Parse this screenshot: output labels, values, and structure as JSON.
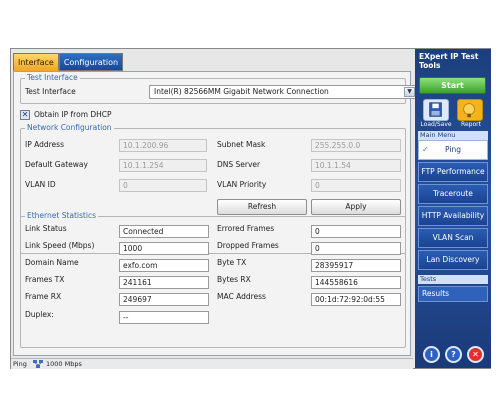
{
  "tabs": [
    "Interface",
    "Configuration"
  ],
  "test_interface": {
    "group_title": "Test Interface",
    "label": "Test Interface",
    "value": "Intel(R) 82566MM Gigabit Network Connection"
  },
  "dhcp": {
    "label": "Obtain IP from DHCP",
    "checked": true
  },
  "network": {
    "group_title": "Network Configuration",
    "ip_label": "IP Address",
    "ip_value": "10.1.200.96",
    "subnet_label": "Subnet Mask",
    "subnet_value": "255.255.0.0",
    "gateway_label": "Default Gateway",
    "gateway_value": "10.1.1.254",
    "dns_label": "DNS Server",
    "dns_value": "10.1.1.54",
    "vlan_id_label": "VLAN ID",
    "vlan_id_value": "0",
    "vlan_priority_label": "VLAN Priority",
    "vlan_priority_value": "0",
    "refresh_label": "Refresh",
    "apply_label": "Apply"
  },
  "ethernet": {
    "group_title": "Ethernet Statistics",
    "link_status_label": "Link Status",
    "link_status_value": "Connected",
    "link_speed_label": "Link Speed (Mbps)",
    "link_speed_value": "1000",
    "domain_label": "Domain Name",
    "domain_value": "exfo.com",
    "frames_tx_label": "Frames TX",
    "frames_tx_value": "241161",
    "frame_rx_label": "Frame RX",
    "frame_rx_value": "249697",
    "duplex_label": "Duplex:",
    "duplex_value": "--",
    "errored_label": "Errored Frames",
    "errored_value": "0",
    "dropped_label": "Dropped Frames",
    "dropped_value": "0",
    "byte_tx_label": "Byte TX",
    "byte_tx_value": "28395917",
    "bytes_rx_label": "Bytes RX",
    "bytes_rx_value": "144558616",
    "mac_label": "MAC Address",
    "mac_value": "00:1d:72:92:0d:55"
  },
  "statusbar": {
    "mode": "Ping",
    "speed": "1000 Mbps"
  },
  "sidebar": {
    "app_title_line1": "EXpert IP Test",
    "app_title_line2": "Tools",
    "start_label": "Start",
    "load_save_label": "Load/Save",
    "report_label": "Report",
    "main_menu_label": "Main Menu",
    "menu_items": [
      "Ping",
      "FTP Performance",
      "Traceroute",
      "HTTP Availability",
      "VLAN Scan",
      "Lan Discovery"
    ],
    "selected_item": "Ping",
    "tests_label": "Tests",
    "results_label": "Results",
    "info_glyph": "i",
    "help_glyph": "?",
    "close_glyph": "✕"
  },
  "colors": {
    "accent_tab": "#f2a825",
    "sidebar_blue": "#2852a0",
    "start_green": "#39a32a",
    "group_title_blue": "#3769b0"
  },
  "icons": [
    "checkbox-checked-icon",
    "dropdown-arrow-icon",
    "network-icon",
    "load-save-icon",
    "report-icon",
    "check-icon",
    "info-icon",
    "help-icon",
    "close-icon"
  ]
}
